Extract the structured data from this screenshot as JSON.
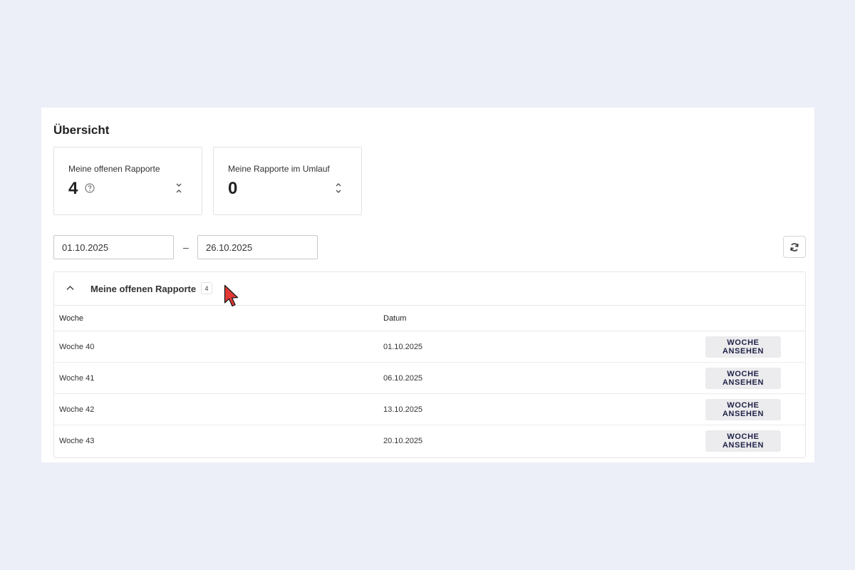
{
  "page": {
    "title": "Übersicht"
  },
  "cards": [
    {
      "label": "Meine offenen Rapporte",
      "value": "4",
      "icon": "help-circle-icon",
      "sort_icon": "sort-collapse-icon"
    },
    {
      "label": "Meine Rapporte im Umlauf",
      "value": "0",
      "sort_icon": "sort-expand-icon"
    }
  ],
  "filter": {
    "date_from": "01.10.2025",
    "separator": "–",
    "date_to": "26.10.2025",
    "refresh_icon": "refresh-icon"
  },
  "section": {
    "title": "Meine offenen Rapporte",
    "count": "4",
    "collapse_icon": "chevron-up-icon",
    "columns": [
      "Woche",
      "Datum"
    ],
    "rows": [
      {
        "week": "Woche 40",
        "date": "01.10.2025",
        "action": "WOCHE ANSEHEN"
      },
      {
        "week": "Woche 41",
        "date": "06.10.2025",
        "action": "WOCHE ANSEHEN"
      },
      {
        "week": "Woche 42",
        "date": "13.10.2025",
        "action": "WOCHE ANSEHEN"
      },
      {
        "week": "Woche 43",
        "date": "20.10.2025",
        "action": "WOCHE ANSEHEN"
      }
    ]
  },
  "colors": {
    "background": "#eceff7",
    "button_bg": "#ececee",
    "button_text": "#1e2146",
    "cursor": "#e53935"
  }
}
